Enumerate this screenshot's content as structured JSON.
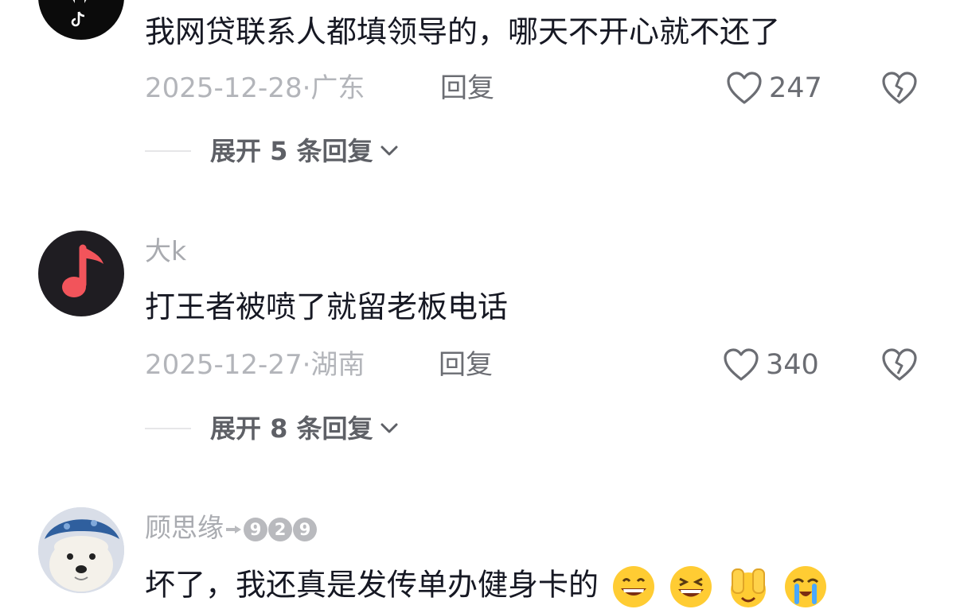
{
  "comments": [
    {
      "username": "",
      "text": "我网贷联系人都填领导的，哪天不开心就不还了",
      "date": "2025-12-28",
      "sep": "·",
      "region": "广东",
      "reply_label": "回复",
      "likes": "247",
      "expand_label": "展开 5 条回复",
      "avatar_icon": "tiktok-logo-icon"
    },
    {
      "username": "大k",
      "text": "打王者被喷了就留老板电话",
      "date": "2025-12-27",
      "sep": "·",
      "region": "湖南",
      "reply_label": "回复",
      "likes": "340",
      "expand_label": "展开 8 条回复",
      "avatar_icon": "music-note-icon"
    },
    {
      "username": "顾思缘",
      "badge_digits": [
        "9",
        "2",
        "9"
      ],
      "text": "坏了，我还真是发传单办健身卡的",
      "avatar_icon": "dog-avatar-icon",
      "emojis": [
        "grin-emoji-icon",
        "squint-laugh-emoji-icon",
        "hands-up-emoji-icon",
        "crying-laugh-emoji-icon"
      ]
    }
  ],
  "colors": {
    "text_primary": "#161823",
    "text_secondary": "#a9abb0",
    "avatar_music_bg": "#1f1d22",
    "avatar_music_note": "#f2545b"
  }
}
